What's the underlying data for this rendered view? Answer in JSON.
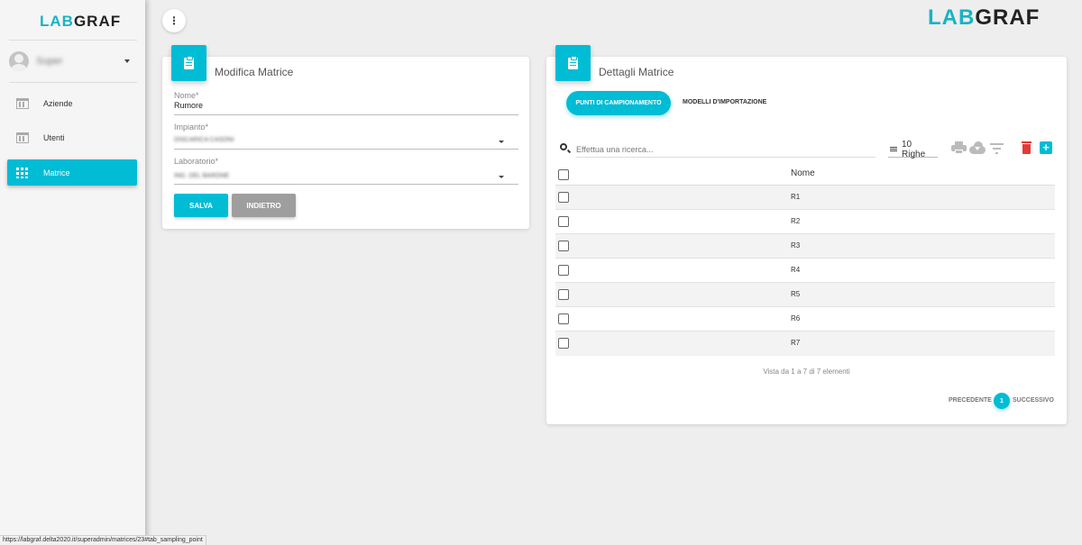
{
  "logo": {
    "part1": "LAB",
    "part2": "GRAF"
  },
  "sidebar": {
    "user": {
      "name": "Super"
    },
    "items": [
      {
        "label": "Aziende",
        "icon": "building-icon",
        "active": false
      },
      {
        "label": "Utenti",
        "icon": "building-icon",
        "active": false
      },
      {
        "label": "Matrice",
        "icon": "grid-icon",
        "active": true
      }
    ]
  },
  "topbar": {
    "menu_icon": "⋮"
  },
  "edit_card": {
    "title": "Modifica Matrice",
    "fields": {
      "nome": {
        "label": "Nome*",
        "value": "Rumore"
      },
      "impianto": {
        "label": "Impianto*",
        "value": "DISCARICA CASONI"
      },
      "laboratorio": {
        "label": "Laboratorio*",
        "value": "ING. DEL BARONE"
      }
    },
    "save_label": "SALVA",
    "back_label": "INDIETRO"
  },
  "details_card": {
    "title": "Dettagli Matrice",
    "tabs": [
      {
        "label": "PUNTI DI CAMPIONAMENTO",
        "active": true
      },
      {
        "label": "MODELLI D'IMPORTAZIONE",
        "active": false
      }
    ],
    "search_placeholder": "Effettua una ricerca...",
    "rows_label": "10 Righe",
    "table": {
      "header": "Nome",
      "rows": [
        "R1",
        "R2",
        "R3",
        "R4",
        "R5",
        "R6",
        "R7"
      ]
    },
    "info": "Vista da 1 a 7 di 7 elementi",
    "pager": {
      "prev": "PRECEDENTE",
      "page": "1",
      "next": "SUCCESSIVO"
    }
  },
  "status_url": "https://labgraf.delta2020.it/superadmin/matrices/23#tab_sampling_point",
  "colors": {
    "accent": "#00bcd4",
    "danger": "#e53935",
    "secondary_button": "#9e9e9e"
  }
}
